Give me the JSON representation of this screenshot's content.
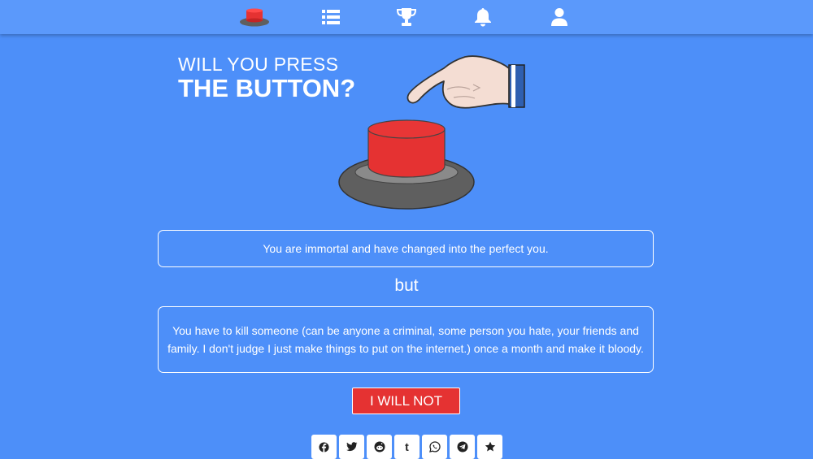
{
  "nav": {
    "items": [
      {
        "icon": "red-button-icon"
      },
      {
        "icon": "list-icon"
      },
      {
        "icon": "trophy-icon"
      },
      {
        "icon": "bell-icon"
      },
      {
        "icon": "user-icon"
      }
    ]
  },
  "title": {
    "line1": "WILL YOU PRESS",
    "line2": "THE BUTTON?"
  },
  "dilemma": {
    "pro": "You are immortal and have changed into the perfect you.",
    "connector": "but",
    "con": "You have to kill someone (can be anyone a criminal, some person you hate, your friends and family. I don't judge I just make things to put on the internet.) once a month and make it bloody."
  },
  "actions": {
    "refuse_label": "I WILL NOT"
  },
  "share": {
    "buttons": [
      "facebook-icon",
      "twitter-icon",
      "reddit-icon",
      "tumblr-icon",
      "whatsapp-icon",
      "telegram-icon",
      "star-icon"
    ]
  },
  "colors": {
    "background": "#4d8ff9",
    "navbar": "#5b99fb",
    "button_red": "#e53232",
    "base_gray": "#5f5f5f"
  }
}
